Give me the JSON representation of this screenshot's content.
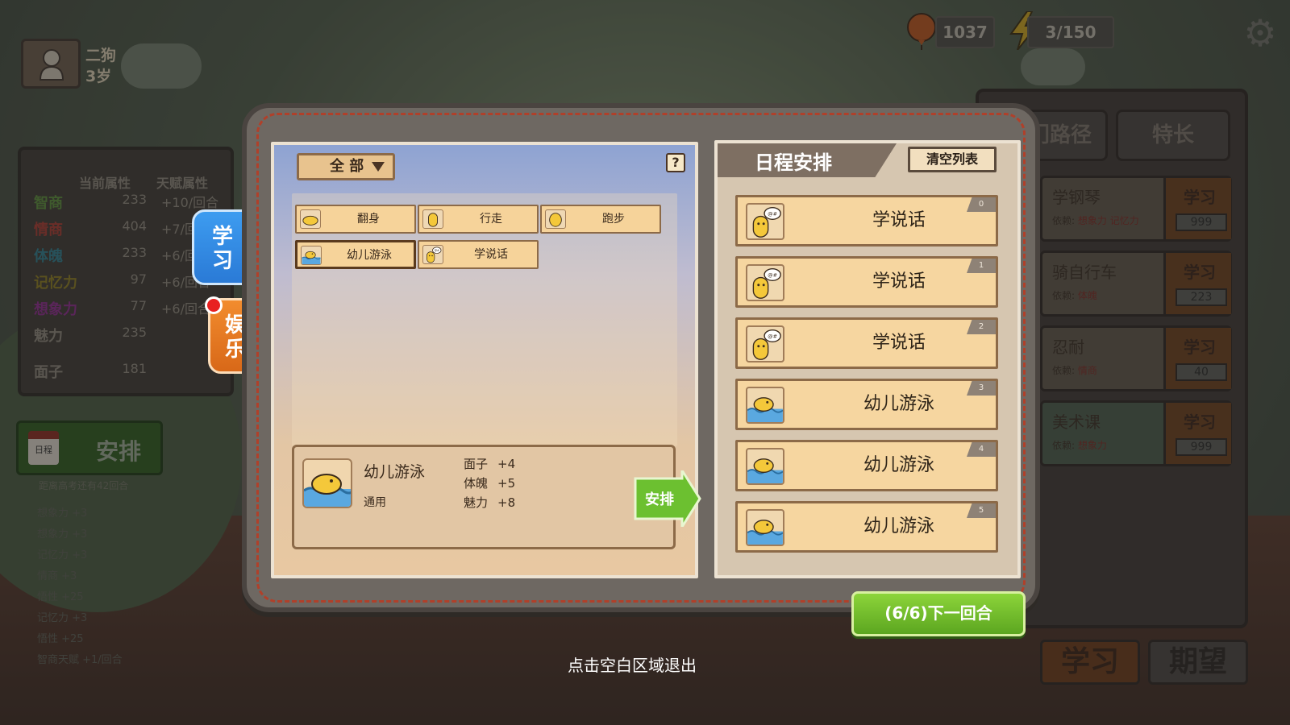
{
  "profile": {
    "name": "二狗",
    "age": "3岁"
  },
  "resources": {
    "coins": "1037",
    "energy": "3/150"
  },
  "stats_panel": {
    "header_current": "当前属性",
    "header_talent": "天赋属性",
    "rows": [
      {
        "name": "智商",
        "value": "233",
        "bonus": "+10/回合",
        "color": "#5a8a3a"
      },
      {
        "name": "情商",
        "value": "404",
        "bonus": "+7/回",
        "color": "#a83a30"
      },
      {
        "name": "体魄",
        "value": "233",
        "bonus": "+6/回",
        "color": "#2e7a8a"
      },
      {
        "name": "记忆力",
        "value": "97",
        "bonus": "+6/回合",
        "color": "#8a7a20"
      },
      {
        "name": "想象力",
        "value": "77",
        "bonus": "+6/回合",
        "color": "#8a2a8a"
      },
      {
        "name": "魅力",
        "value": "235",
        "bonus": "",
        "color": "#8a8478"
      },
      {
        "name": "面子",
        "value": "181",
        "bonus": "",
        "color": "#8a8478"
      }
    ]
  },
  "arrange_button": {
    "calendar": "日程",
    "label": "安排"
  },
  "countdown_note": "距离高考还有42回合",
  "log_lines": [
    "想象力 +3",
    "想象力 +3",
    "记忆力 +3",
    "情商 +3",
    "悟性 +25",
    "记忆力 +3",
    "悟性 +25",
    "智商天赋 +1/回合"
  ],
  "right_panel": {
    "tabs": [
      "门路径",
      "特长"
    ],
    "cards": [
      {
        "title": "学钢琴",
        "dep_label": "依赖:",
        "dep": "想象力 记忆力",
        "btn": "学习",
        "cost": "999"
      },
      {
        "title": "骑自行车",
        "dep_label": "依赖:",
        "dep": "体魄",
        "btn": "学习",
        "cost": "223"
      },
      {
        "title": "忍耐",
        "dep_label": "依赖:",
        "dep": "情商",
        "btn": "学习",
        "cost": "40"
      },
      {
        "title": "美术课",
        "dep_label": "依赖:",
        "dep": "想象力",
        "btn": "学习",
        "cost": "999"
      }
    ],
    "bottom_buttons": [
      "学习",
      "期望"
    ]
  },
  "side_tabs": {
    "study": "学\n习",
    "fun": "娱\n乐"
  },
  "left_page": {
    "filter": "全 部",
    "help": "?",
    "activities": [
      {
        "label": "翻身",
        "icon": "rolling-chick-icon"
      },
      {
        "label": "行走",
        "icon": "walking-chick-icon"
      },
      {
        "label": "跑步",
        "icon": "running-chick-icon"
      },
      {
        "label": "幼儿游泳",
        "icon": "swimming-chick-icon",
        "selected": true
      },
      {
        "label": "学说话",
        "icon": "talking-chick-icon"
      }
    ],
    "detail": {
      "name": "幼儿游泳",
      "tag": "通用",
      "effects": [
        {
          "attr": "面子",
          "val": "+4"
        },
        {
          "attr": "体魄",
          "val": "+5"
        },
        {
          "attr": "魅力",
          "val": "+8"
        }
      ],
      "button": "安排"
    }
  },
  "schedule": {
    "title": "日程安排",
    "clear": "清空列表",
    "slots": [
      {
        "label": "学说话",
        "index": "0",
        "icon": "talking-chick-icon"
      },
      {
        "label": "学说话",
        "index": "1",
        "icon": "talking-chick-icon"
      },
      {
        "label": "学说话",
        "index": "2",
        "icon": "talking-chick-icon"
      },
      {
        "label": "幼儿游泳",
        "index": "3",
        "icon": "swimming-chick-icon"
      },
      {
        "label": "幼儿游泳",
        "index": "4",
        "icon": "swimming-chick-icon"
      },
      {
        "label": "幼儿游泳",
        "index": "5",
        "icon": "swimming-chick-icon"
      }
    ]
  },
  "next_round": "(6/6)下一回合",
  "exit_hint": "点击空白区域退出",
  "colors": {
    "study_tab": "#2a7ad6",
    "fun_tab": "#d86818",
    "next_button": "#5ca620",
    "accent_red": "#e82020"
  }
}
